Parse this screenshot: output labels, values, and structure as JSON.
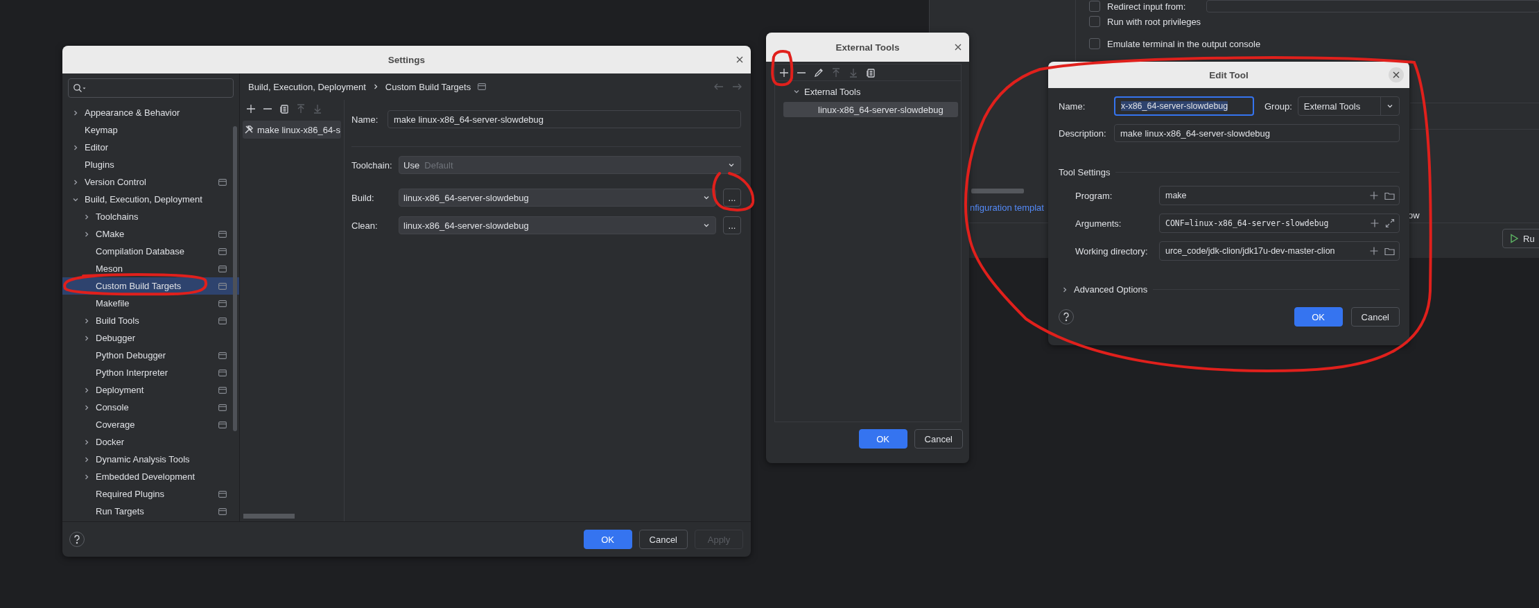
{
  "background_window": {
    "options": [
      {
        "label": "Redirect input from:",
        "checked": false
      },
      {
        "label": "Run with root privileges",
        "checked": false
      },
      {
        "label": "Emulate terminal in the output console",
        "checked": false
      }
    ],
    "link": "nfiguration templat",
    "text_fragment": "ow",
    "run_button": "Ru"
  },
  "settings": {
    "title": "Settings",
    "tree": [
      {
        "label": "Appearance & Behavior",
        "expanded": false,
        "scoped": false,
        "selected": false
      },
      {
        "label": "Keymap",
        "scoped": false,
        "selected": false
      },
      {
        "label": "Editor",
        "expanded": false,
        "scoped": false,
        "selected": false
      },
      {
        "label": "Plugins",
        "scoped": false,
        "selected": false
      },
      {
        "label": "Version Control",
        "expanded": false,
        "scoped": true,
        "selected": false
      },
      {
        "label": "Build, Execution, Deployment",
        "expanded": true,
        "scoped": false,
        "selected": false,
        "children": [
          {
            "label": "Toolchains",
            "expanded": false,
            "scoped": false,
            "selected": false
          },
          {
            "label": "CMake",
            "expanded": false,
            "scoped": true,
            "selected": false
          },
          {
            "label": "Compilation Database",
            "scoped": true,
            "selected": false
          },
          {
            "label": "Meson",
            "scoped": true,
            "selected": false
          },
          {
            "label": "Custom Build Targets",
            "scoped": true,
            "selected": true
          },
          {
            "label": "Makefile",
            "scoped": true,
            "selected": false
          },
          {
            "label": "Build Tools",
            "expanded": false,
            "scoped": true,
            "selected": false
          },
          {
            "label": "Debugger",
            "expanded": false,
            "scoped": false,
            "selected": false
          },
          {
            "label": "Python Debugger",
            "scoped": true,
            "selected": false
          },
          {
            "label": "Python Interpreter",
            "scoped": true,
            "selected": false
          },
          {
            "label": "Deployment",
            "expanded": false,
            "scoped": true,
            "selected": false
          },
          {
            "label": "Console",
            "expanded": false,
            "scoped": true,
            "selected": false
          },
          {
            "label": "Coverage",
            "scoped": true,
            "selected": false
          },
          {
            "label": "Docker",
            "expanded": false,
            "scoped": false,
            "selected": false
          },
          {
            "label": "Dynamic Analysis Tools",
            "expanded": false,
            "scoped": false,
            "selected": false
          },
          {
            "label": "Embedded Development",
            "expanded": false,
            "scoped": false,
            "selected": false
          },
          {
            "label": "Required Plugins",
            "scoped": true,
            "selected": false
          },
          {
            "label": "Run Targets",
            "scoped": true,
            "selected": false
          }
        ]
      }
    ],
    "breadcrumb": [
      "Build, Execution, Deployment",
      "Custom Build Targets"
    ],
    "nav": [
      {
        "kind": "back",
        "disabled": true
      },
      {
        "kind": "forward",
        "disabled": true
      }
    ],
    "toolbar": [
      {
        "kind": "add",
        "disabled": false
      },
      {
        "kind": "remove",
        "disabled": false
      },
      {
        "kind": "copy",
        "disabled": false
      },
      {
        "kind": "up",
        "disabled": true
      },
      {
        "kind": "down",
        "disabled": true
      }
    ],
    "targets": [
      {
        "label": "make linux-x86_64-s",
        "selected": true
      }
    ],
    "name_field": {
      "label": "Name:",
      "value": "make linux-x86_64-server-slowdebug"
    },
    "toolchain": {
      "label": "Toolchain:",
      "value": "Use",
      "hint": "Default"
    },
    "commands": [
      {
        "label": "Build:",
        "value": "linux-x86_64-server-slowdebug",
        "button": "..."
      },
      {
        "label": "Clean:",
        "value": "linux-x86_64-server-slowdebug",
        "button": "..."
      }
    ],
    "buttons": [
      {
        "label": "OK",
        "kind": "primary"
      },
      {
        "label": "Cancel",
        "kind": "normal"
      },
      {
        "label": "Apply",
        "kind": "disabled"
      }
    ]
  },
  "external_tools": {
    "title": "External Tools",
    "toolbar": [
      {
        "kind": "add",
        "disabled": false
      },
      {
        "kind": "remove",
        "disabled": false
      },
      {
        "kind": "edit",
        "disabled": false
      },
      {
        "kind": "up",
        "disabled": true
      },
      {
        "kind": "down",
        "disabled": true
      },
      {
        "kind": "copy",
        "disabled": false
      }
    ],
    "tree": [
      {
        "label": "External Tools",
        "expanded": true,
        "selected": false,
        "children": [
          {
            "label": "linux-x86_64-server-slowdebug",
            "selected": true
          }
        ]
      }
    ],
    "buttons": [
      {
        "label": "OK",
        "kind": "primary"
      },
      {
        "label": "Cancel",
        "kind": "normal"
      }
    ]
  },
  "edit_tool": {
    "title": "Edit Tool",
    "name": {
      "label": "Name:",
      "value": "x-x86_64-server-slowdebug",
      "text_selected": true
    },
    "group": {
      "label": "Group:",
      "value": "External Tools"
    },
    "description": {
      "label": "Description:",
      "value": "make linux-x86_64-server-slowdebug"
    },
    "section": "Tool Settings",
    "settings": [
      {
        "kind": "path",
        "label": "Program:",
        "value": "make"
      },
      {
        "kind": "args",
        "label": "Arguments:",
        "value": "CONF=linux-x86_64-server-slowdebug"
      },
      {
        "kind": "path",
        "label": "Working directory:",
        "value": "urce_code/jdk-clion/jdk17u-dev-master-clion"
      }
    ],
    "advanced": {
      "label": "Advanced Options",
      "expanded": false
    },
    "buttons": [
      {
        "label": "OK",
        "kind": "primary"
      },
      {
        "label": "Cancel",
        "kind": "normal"
      }
    ]
  }
}
